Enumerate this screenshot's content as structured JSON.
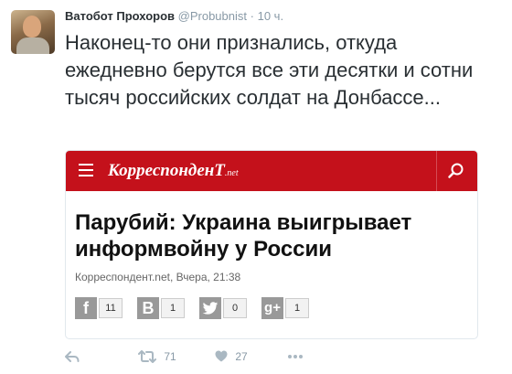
{
  "tweet": {
    "author_name": "Ватобот Прохоров",
    "handle": "@Probubnist",
    "separator": "·",
    "time": "10 ч.",
    "text": "Наконец-то они признались, откуда ежедневно берутся все эти десятки и сотни тысяч российских солдат на Донбассе...",
    "retweet_count": "71",
    "like_count": "27"
  },
  "card": {
    "brand": "КорреспонденТ",
    "brand_suffix": ".net",
    "accent_color": "#c4111b",
    "headline": "Парубий: Украина выигрывает информвойну у России",
    "meta": "Корреспондент.net, Вчера, 21:38",
    "shares": [
      {
        "icon": "facebook-icon",
        "glyph": "f",
        "count": "11"
      },
      {
        "icon": "vkontakte-icon",
        "glyph": "B",
        "count": "1"
      },
      {
        "icon": "twitter-icon",
        "glyph": "",
        "count": "0"
      },
      {
        "icon": "google-plus-icon",
        "glyph": "g+",
        "count": "1"
      }
    ]
  }
}
